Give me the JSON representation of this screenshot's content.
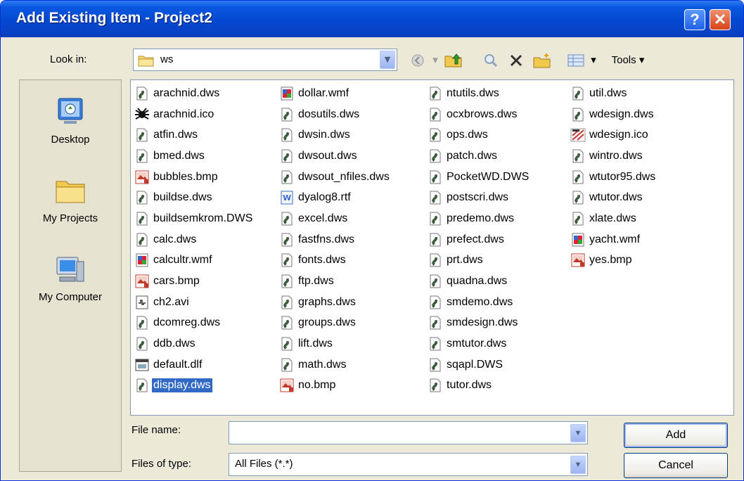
{
  "window": {
    "title": "Add Existing Item - Project2",
    "help_label": "?",
    "close_label": "✕"
  },
  "lookin": {
    "label": "Look in:",
    "value": "ws"
  },
  "toolbar": {
    "tools_label": "Tools"
  },
  "places": [
    {
      "label": "Desktop",
      "icon": "desktop-icon"
    },
    {
      "label": "My Projects",
      "icon": "folder-icon"
    },
    {
      "label": "My Computer",
      "icon": "computer-icon"
    }
  ],
  "files": {
    "col1": [
      {
        "name": "arachnid.dws",
        "icon": "dws"
      },
      {
        "name": "arachnid.ico",
        "icon": "spider"
      },
      {
        "name": "atfin.dws",
        "icon": "dws"
      },
      {
        "name": "bmed.dws",
        "icon": "dws"
      },
      {
        "name": "bubbles.bmp",
        "icon": "bmp"
      },
      {
        "name": "buildse.dws",
        "icon": "dws"
      },
      {
        "name": "buildsemkrom.DWS",
        "icon": "dws"
      },
      {
        "name": "calc.dws",
        "icon": "dws"
      },
      {
        "name": "calcultr.wmf",
        "icon": "wmf"
      },
      {
        "name": "cars.bmp",
        "icon": "bmp"
      },
      {
        "name": "ch2.avi",
        "icon": "avi"
      },
      {
        "name": "dcomreg.dws",
        "icon": "dws"
      },
      {
        "name": "ddb.dws",
        "icon": "dws"
      },
      {
        "name": "default.dlf",
        "icon": "dlf"
      },
      {
        "name": "display.dws",
        "icon": "dws",
        "selected": true
      }
    ],
    "col2": [
      {
        "name": "dollar.wmf",
        "icon": "wmf"
      },
      {
        "name": "dosutils.dws",
        "icon": "dws"
      },
      {
        "name": "dwsin.dws",
        "icon": "dws"
      },
      {
        "name": "dwsout.dws",
        "icon": "dws"
      },
      {
        "name": "dwsout_nfiles.dws",
        "icon": "dws"
      },
      {
        "name": "dyalog8.rtf",
        "icon": "rtf"
      },
      {
        "name": "excel.dws",
        "icon": "dws"
      },
      {
        "name": "fastfns.dws",
        "icon": "dws"
      },
      {
        "name": "fonts.dws",
        "icon": "dws"
      },
      {
        "name": "ftp.dws",
        "icon": "dws"
      },
      {
        "name": "graphs.dws",
        "icon": "dws"
      },
      {
        "name": "groups.dws",
        "icon": "dws"
      },
      {
        "name": "lift.dws",
        "icon": "dws"
      },
      {
        "name": "math.dws",
        "icon": "dws"
      },
      {
        "name": "no.bmp",
        "icon": "bmp"
      }
    ],
    "col3": [
      {
        "name": "ntutils.dws",
        "icon": "dws"
      },
      {
        "name": "ocxbrows.dws",
        "icon": "dws"
      },
      {
        "name": "ops.dws",
        "icon": "dws"
      },
      {
        "name": "patch.dws",
        "icon": "dws"
      },
      {
        "name": "PocketWD.DWS",
        "icon": "dws"
      },
      {
        "name": "postscri.dws",
        "icon": "dws"
      },
      {
        "name": "predemo.dws",
        "icon": "dws"
      },
      {
        "name": "prefect.dws",
        "icon": "dws"
      },
      {
        "name": "prt.dws",
        "icon": "dws"
      },
      {
        "name": "quadna.dws",
        "icon": "dws"
      },
      {
        "name": "smdemo.dws",
        "icon": "dws"
      },
      {
        "name": "smdesign.dws",
        "icon": "dws"
      },
      {
        "name": "smtutor.dws",
        "icon": "dws"
      },
      {
        "name": "sqapl.DWS",
        "icon": "dws"
      },
      {
        "name": "tutor.dws",
        "icon": "dws"
      }
    ],
    "col4": [
      {
        "name": "util.dws",
        "icon": "dws"
      },
      {
        "name": "wdesign.dws",
        "icon": "dws"
      },
      {
        "name": "wdesign.ico",
        "icon": "ico"
      },
      {
        "name": "wintro.dws",
        "icon": "dws"
      },
      {
        "name": "wtutor95.dws",
        "icon": "dws"
      },
      {
        "name": "wtutor.dws",
        "icon": "dws"
      },
      {
        "name": "xlate.dws",
        "icon": "dws"
      },
      {
        "name": "yacht.wmf",
        "icon": "wmf"
      },
      {
        "name": "yes.bmp",
        "icon": "bmp"
      }
    ]
  },
  "filename": {
    "label": "File name:",
    "value": ""
  },
  "filetype": {
    "label": "Files of type:",
    "value": "All Files (*.*)"
  },
  "buttons": {
    "add": "Add",
    "cancel": "Cancel"
  }
}
